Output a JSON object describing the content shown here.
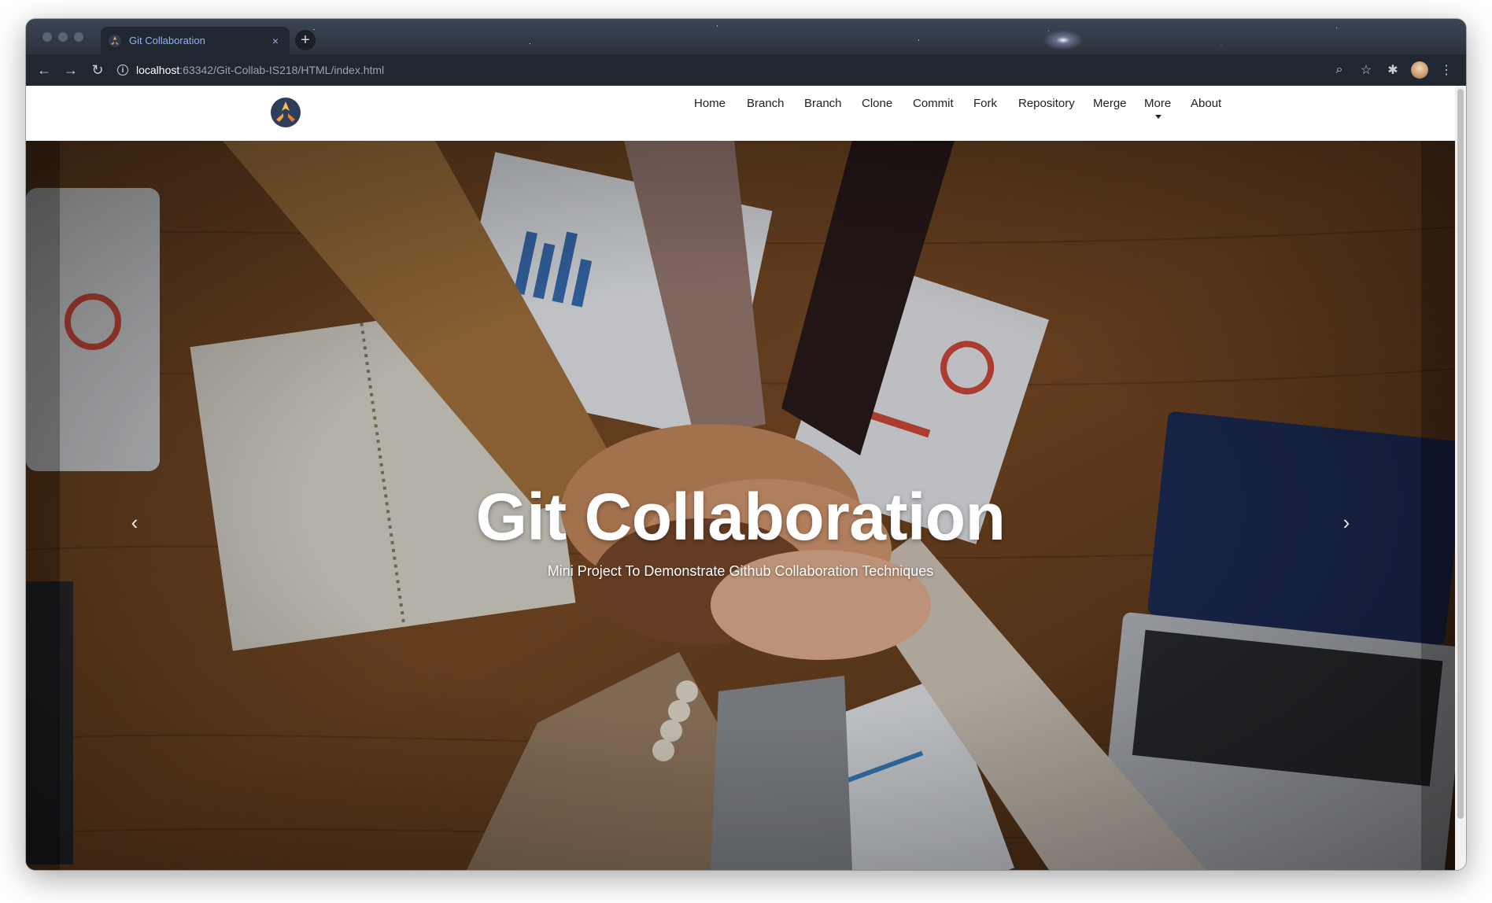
{
  "browser": {
    "tab_title": "Git Collaboration",
    "tab_close": "×",
    "new_tab": "+",
    "url_host": "localhost",
    "url_rest": ":63342/Git-Collab-IS218/HTML/index.html",
    "back": "←",
    "forward": "→",
    "reload": "↻",
    "info": "i",
    "zoom_icon": "⌕",
    "star_icon": "☆",
    "extensions_icon": "✱",
    "menu_icon": "⋮"
  },
  "site": {
    "nav": {
      "home": "Home",
      "branch_1": "Branch",
      "branch_2": "Branch",
      "clone": "Clone",
      "commit": "Commit",
      "fork": "Fork",
      "repository": "Repository",
      "merge": "Merge",
      "more": "More",
      "about": "About"
    },
    "hero": {
      "title": "Git Collaboration",
      "subtitle": "Mini Project To Demonstrate Github Collaboration Techniques",
      "prev": "‹",
      "next": "›"
    }
  },
  "colors": {
    "tab_text": "#8ab4f8",
    "toolbar_bg": "#202731",
    "navbar_bg": "#ffffff",
    "hero_text": "#ffffff"
  }
}
